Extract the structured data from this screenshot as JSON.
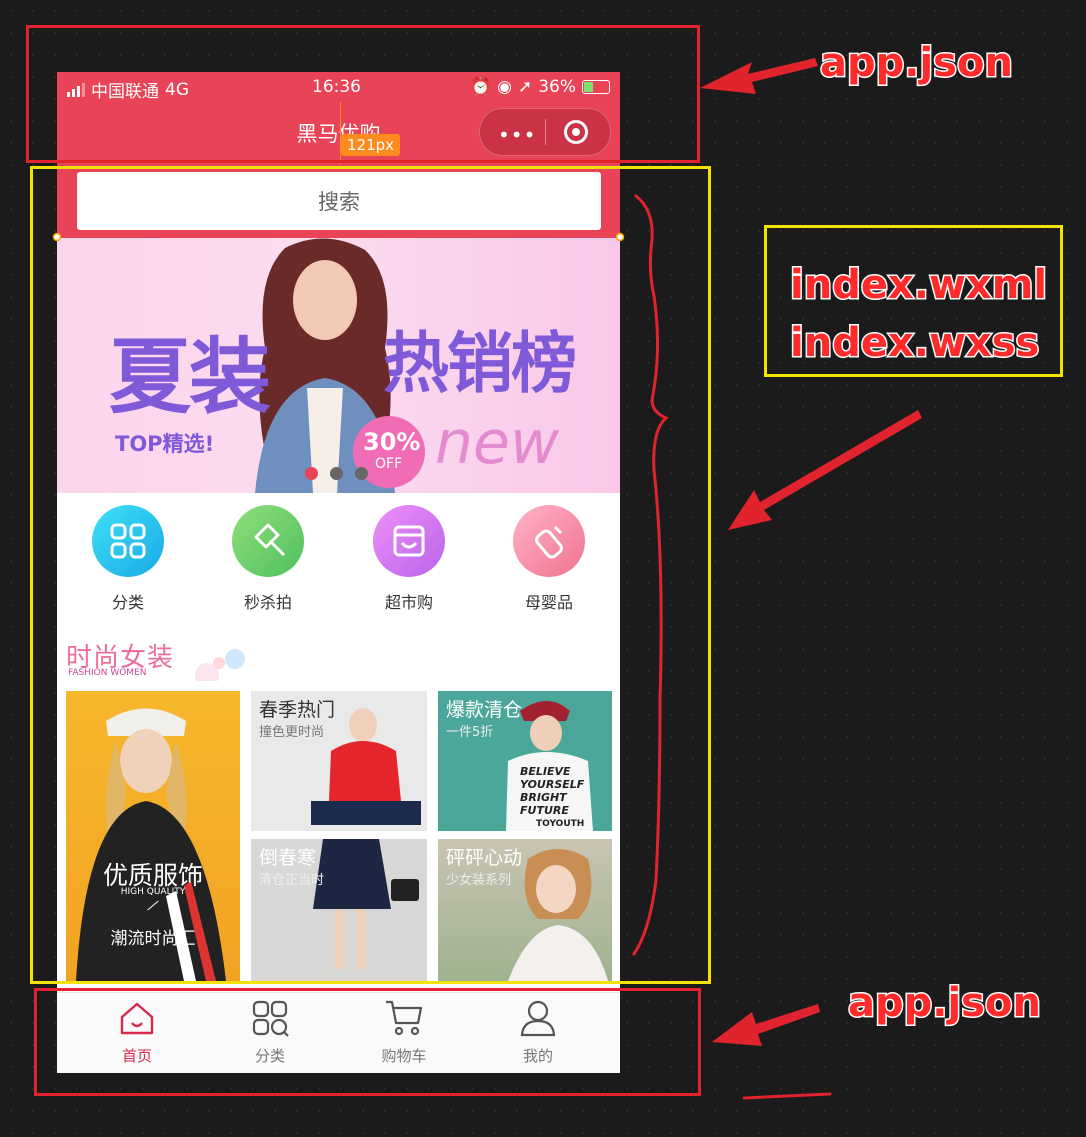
{
  "status_bar": {
    "carrier": "中国联通",
    "network": "4G",
    "time": "16:36",
    "battery": "36%"
  },
  "nav_bar": {
    "title": "黑马优购",
    "measure": "121px"
  },
  "search": {
    "placeholder": "搜索"
  },
  "banner": {
    "headline_left": "夏装",
    "headline_right": "热销榜",
    "tagline": "TOP精选!",
    "discount": "30%",
    "off": "OFF",
    "script_text": "new",
    "dot_count": 3,
    "active_dot": 0
  },
  "categories": [
    {
      "label": "分类",
      "icon": "grid-icon",
      "color": "#2fc6ea"
    },
    {
      "label": "秒杀拍",
      "icon": "hammer-icon",
      "color": "#69cf6a"
    },
    {
      "label": "超市购",
      "icon": "store-icon",
      "color": "#d57bf0"
    },
    {
      "label": "母婴品",
      "icon": "baby-bottle-icon",
      "color": "#f889a6"
    }
  ],
  "floor": {
    "title": "时尚女装",
    "subtitle": "FASHION WOMEN",
    "main_tile": {
      "title": "优质服饰",
      "en": "HIGH QUALITY",
      "sub": "潮流时尚汇"
    },
    "tiles": [
      {
        "title": "春季热门",
        "sub": "撞色更时尚"
      },
      {
        "title": "爆款清仓",
        "sub": "一件5折"
      },
      {
        "title": "倒春寒",
        "sub": "清仓正当时"
      },
      {
        "title": "砰砰心动",
        "sub": "少女装系列"
      }
    ],
    "shirt_text": "BELIEVE YOURSELF BRIGHT FUTURE",
    "shirt_brand": "TOYOUTH"
  },
  "tab_bar": {
    "items": [
      {
        "label": "首页",
        "icon": "home-icon",
        "active": true
      },
      {
        "label": "分类",
        "icon": "category-icon",
        "active": false
      },
      {
        "label": "购物车",
        "icon": "cart-icon",
        "active": false
      },
      {
        "label": "我的",
        "icon": "user-icon",
        "active": false
      }
    ]
  },
  "annotations": {
    "top_label": "app.json",
    "middle_label_1": "index.wxml",
    "middle_label_2": "index.wxss",
    "bottom_label": "app.json"
  },
  "colors": {
    "brand_red": "#e84356",
    "annotation_red": "#e0232d",
    "annotation_yellow": "#f4e300",
    "tab_active": "#d7284d"
  }
}
